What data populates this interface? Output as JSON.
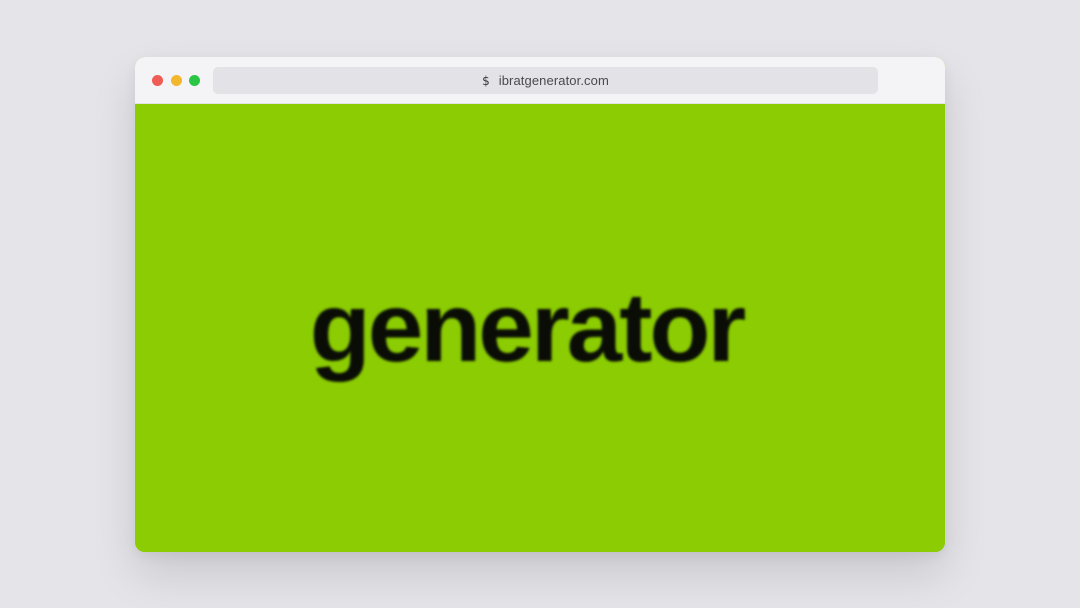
{
  "browser": {
    "traffic_lights": [
      {
        "name": "close",
        "color": "#ef5b55"
      },
      {
        "name": "minimize",
        "color": "#f3b72e"
      },
      {
        "name": "maximize",
        "color": "#2cc646"
      }
    ],
    "address_icon": "dollar-sign",
    "address_icon_glyph": "$",
    "url": "ibratgenerator.com"
  },
  "page": {
    "background_color": "#8bcc02",
    "wordmark": "generator",
    "wordmark_color": "#0a0d06"
  }
}
